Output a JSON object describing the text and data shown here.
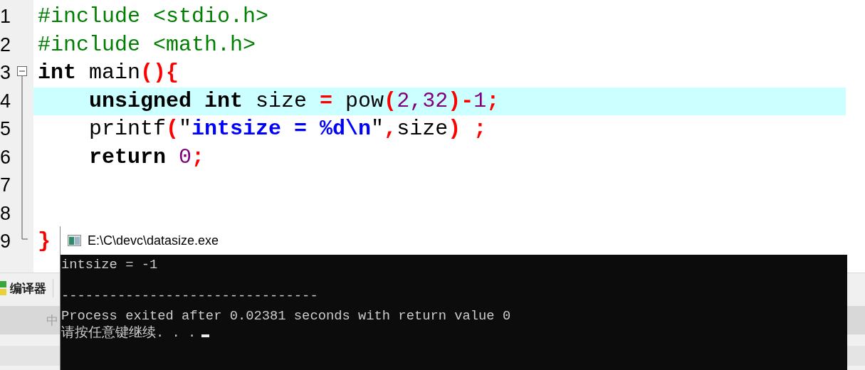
{
  "editor": {
    "fold_marker": {
      "expanded": true
    },
    "lines": [
      {
        "number": "1",
        "highlighted": false,
        "tokens": [
          {
            "text": "#include <stdio.h>",
            "kind": "preprocessor"
          }
        ]
      },
      {
        "number": "2",
        "highlighted": false,
        "tokens": [
          {
            "text": "#include <math.h>",
            "kind": "preprocessor"
          }
        ]
      },
      {
        "number": "3",
        "highlighted": false,
        "tokens": [
          {
            "text": "int",
            "kind": "keyword"
          },
          {
            "text": " main",
            "kind": "ident"
          },
          {
            "text": "(){",
            "kind": "symbol"
          }
        ]
      },
      {
        "number": "4",
        "highlighted": true,
        "tokens": [
          {
            "text": "    unsigned int",
            "kind": "keyword"
          },
          {
            "text": " size ",
            "kind": "ident"
          },
          {
            "text": "=",
            "kind": "symbol"
          },
          {
            "text": " pow",
            "kind": "ident"
          },
          {
            "text": "(",
            "kind": "symbol"
          },
          {
            "text": "2,32",
            "kind": "number"
          },
          {
            "text": ")-",
            "kind": "symbol"
          },
          {
            "text": "1",
            "kind": "number"
          },
          {
            "text": ";",
            "kind": "symbol"
          }
        ]
      },
      {
        "number": "5",
        "highlighted": false,
        "tokens": [
          {
            "text": "    printf",
            "kind": "ident"
          },
          {
            "text": "(",
            "kind": "symbol"
          },
          {
            "text": "\"",
            "kind": "ident"
          },
          {
            "text": "intsize = %d\\n",
            "kind": "string"
          },
          {
            "text": "\"",
            "kind": "ident"
          },
          {
            "text": ",",
            "kind": "symbol"
          },
          {
            "text": "size",
            "kind": "ident"
          },
          {
            "text": ") ",
            "kind": "symbol"
          },
          {
            "text": ";",
            "kind": "symbol"
          }
        ]
      },
      {
        "number": "6",
        "highlighted": false,
        "tokens": [
          {
            "text": "    return ",
            "kind": "keyword"
          },
          {
            "text": "0",
            "kind": "number"
          },
          {
            "text": ";",
            "kind": "symbol"
          }
        ]
      },
      {
        "number": "7",
        "highlighted": false
      },
      {
        "number": "8",
        "highlighted": false
      },
      {
        "number": "9",
        "highlighted": false,
        "tokens": [
          {
            "text": "}",
            "kind": "symbol"
          }
        ]
      }
    ]
  },
  "bottom_panel": {
    "tab": {
      "label": "编译器"
    },
    "button_text": "中"
  },
  "console": {
    "title": "E:\\C\\devc\\datasize.exe",
    "cursor_visible": true,
    "output": [
      {
        "kind": "text",
        "text": "intsize = -1"
      },
      {
        "kind": "rule",
        "text": "--------------------------------"
      },
      {
        "kind": "text",
        "text": "Process exited after 0.02381 seconds with return value 0"
      },
      {
        "kind": "text",
        "text": "请按任意键继续. . ."
      }
    ]
  }
}
